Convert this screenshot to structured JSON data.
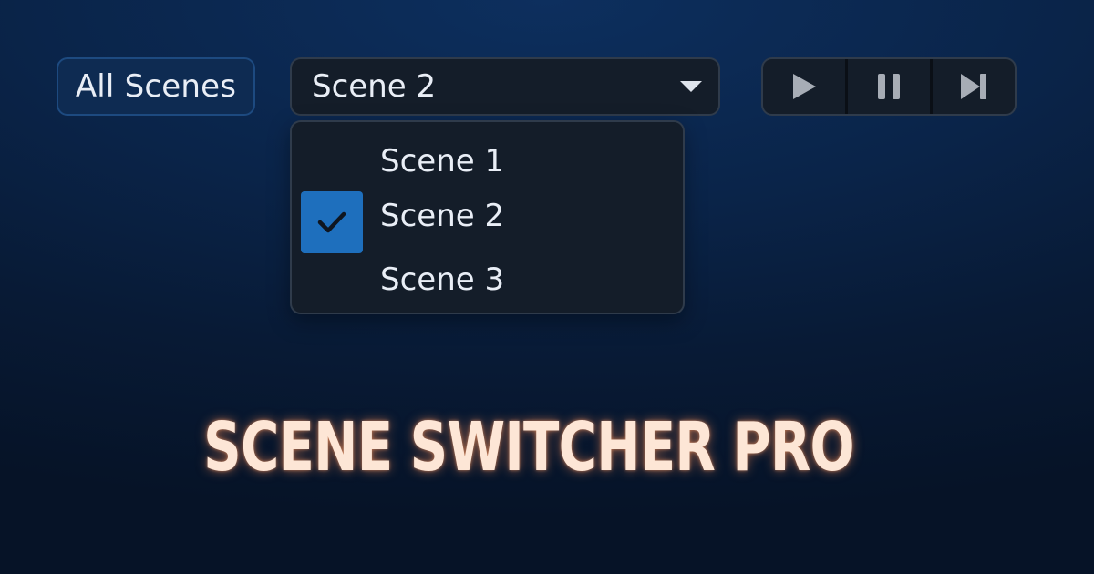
{
  "toolbar": {
    "all_scenes_label": "All Scenes"
  },
  "scene_select": {
    "selected_value": "Scene 2",
    "options": [
      {
        "label": "Scene 1",
        "checked": false
      },
      {
        "label": "Scene 2",
        "checked": true
      },
      {
        "label": "Scene 3",
        "checked": false
      }
    ]
  },
  "media_controls": {
    "buttons": [
      "play-icon",
      "pause-icon",
      "skip-next-icon"
    ]
  },
  "app": {
    "title": "SCENE SWITCHER PRO"
  },
  "colors": {
    "accent": "#1e6fbd",
    "title_glow": "#fde6d6",
    "background": "#0a2449"
  }
}
